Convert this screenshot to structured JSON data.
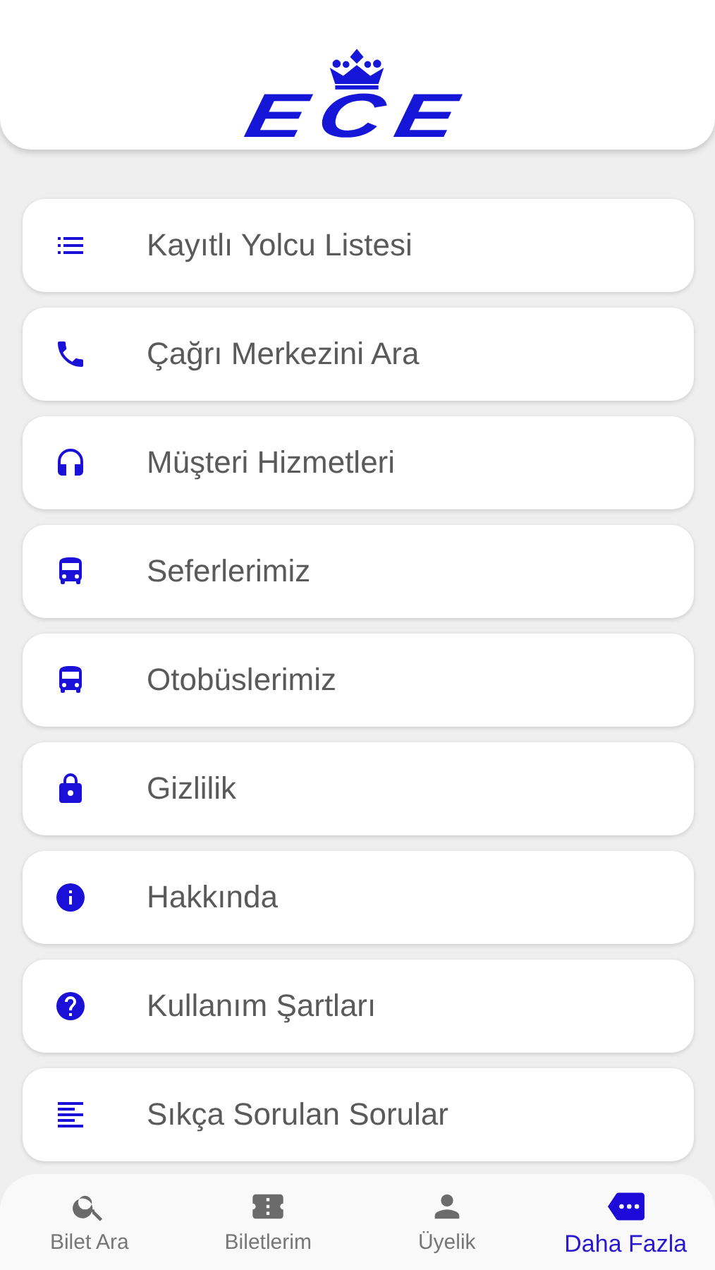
{
  "header": {
    "logo_text": "ECE"
  },
  "menu": [
    {
      "label": "Kayıtlı Yolcu Listesi"
    },
    {
      "label": "Çağrı Merkezini Ara"
    },
    {
      "label": "Müşteri Hizmetleri"
    },
    {
      "label": "Seferlerimiz"
    },
    {
      "label": "Otobüslerimiz"
    },
    {
      "label": "Gizlilik"
    },
    {
      "label": "Hakkında"
    },
    {
      "label": "Kullanım Şartları"
    },
    {
      "label": "Sıkça Sorulan Sorular"
    }
  ],
  "tab_bar": [
    {
      "label": "Bilet Ara",
      "selected": false
    },
    {
      "label": "Biletlerim",
      "selected": false
    },
    {
      "label": "Üyelik",
      "selected": false
    },
    {
      "label": "Daha Fazla",
      "selected": true
    }
  ]
}
